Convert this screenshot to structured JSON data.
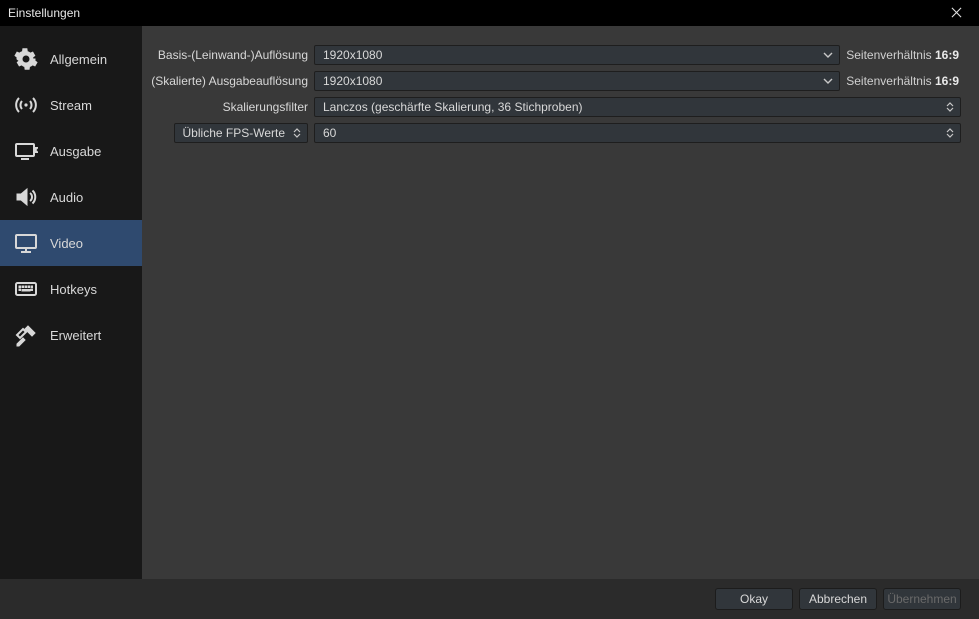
{
  "window": {
    "title": "Einstellungen"
  },
  "sidebar": {
    "items": [
      {
        "key": "allgemein",
        "label": "Allgemein"
      },
      {
        "key": "stream",
        "label": "Stream"
      },
      {
        "key": "ausgabe",
        "label": "Ausgabe"
      },
      {
        "key": "audio",
        "label": "Audio"
      },
      {
        "key": "video",
        "label": "Video"
      },
      {
        "key": "hotkeys",
        "label": "Hotkeys"
      },
      {
        "key": "erweitert",
        "label": "Erweitert"
      }
    ],
    "active": "video"
  },
  "form": {
    "base_res": {
      "label": "Basis-(Leinwand-)Auflösung",
      "value": "1920x1080",
      "aspect_prefix": "Seitenverhältnis ",
      "aspect_ratio": "16:9"
    },
    "scaled_res": {
      "label": "(Skalierte) Ausgabeauflösung",
      "value": "1920x1080",
      "aspect_prefix": "Seitenverhältnis ",
      "aspect_ratio": "16:9"
    },
    "scale_filter": {
      "label": "Skalierungsfilter",
      "value": "Lanczos (geschärfte Skalierung, 36 Stichproben)"
    },
    "fps": {
      "label": "Übliche FPS-Werte",
      "value": "60"
    }
  },
  "footer": {
    "ok": "Okay",
    "cancel": "Abbrechen",
    "apply": "Übernehmen"
  }
}
